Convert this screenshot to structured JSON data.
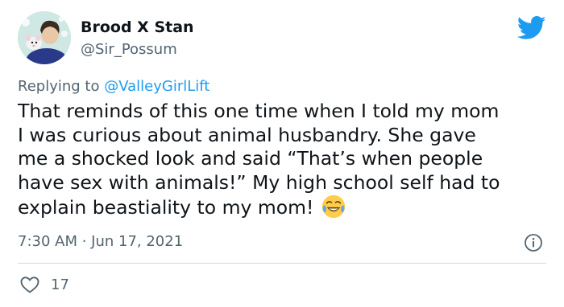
{
  "author": {
    "display_name": "Brood X Stan",
    "handle": "@Sir_Possum",
    "avatar_icon": "avatar-possum-person"
  },
  "brand": {
    "logo_icon": "twitter-bird-icon",
    "logo_color": "#1d9bf0"
  },
  "reply": {
    "prefix": "Replying to ",
    "mention": "@ValleyGirlLift"
  },
  "tweet": {
    "lines": [
      "That reminds of this one time when I told my mom",
      "I was curious about animal husbandry. She gave",
      "me a shocked look and said “That’s when people",
      "have sex with animals!” My high school self had to",
      "explain beastiality to my mom!"
    ],
    "emoji": "face-with-tears-of-joy"
  },
  "meta": {
    "timestamp": "7:30 AM · Jun 17, 2021",
    "info_icon": "info-icon"
  },
  "actions": {
    "like_count": "17",
    "like_icon": "heart-icon"
  },
  "colors": {
    "text_primary": "#0f1419",
    "text_secondary": "#536471",
    "link": "#1d9bf0",
    "divider": "#cfd9de"
  }
}
